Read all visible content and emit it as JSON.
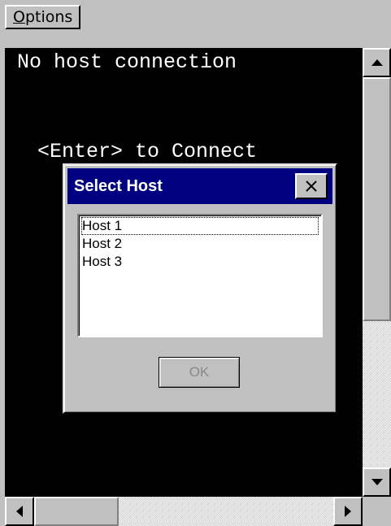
{
  "menu": {
    "options_accel": "O",
    "options_rest": "ptions"
  },
  "terminal": {
    "line1": " No host connection",
    "line2": "<Enter> to Connect"
  },
  "dialog": {
    "title": "Select Host",
    "hosts": [
      "Host 1",
      "Host 2",
      "Host 3"
    ],
    "selected_host": "Host 1",
    "ok_label": "OK",
    "ok_enabled": false
  },
  "icons": {
    "close": "close-icon",
    "scroll_up": "arrow-up-icon",
    "scroll_down": "arrow-down-icon",
    "scroll_left": "arrow-left-icon",
    "scroll_right": "arrow-right-icon"
  },
  "colors": {
    "titlebar": "#000080",
    "terminal_bg": "#000000",
    "terminal_fg": "#ffffff",
    "chrome": "#c0c0c0"
  }
}
